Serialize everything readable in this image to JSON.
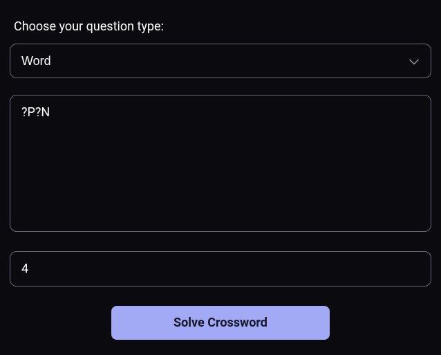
{
  "form": {
    "label": "Choose your question type:",
    "select": {
      "selected": "Word"
    },
    "pattern": {
      "value": "?P?N"
    },
    "length": {
      "value": "4"
    },
    "button": {
      "label": "Solve Crossword"
    }
  }
}
